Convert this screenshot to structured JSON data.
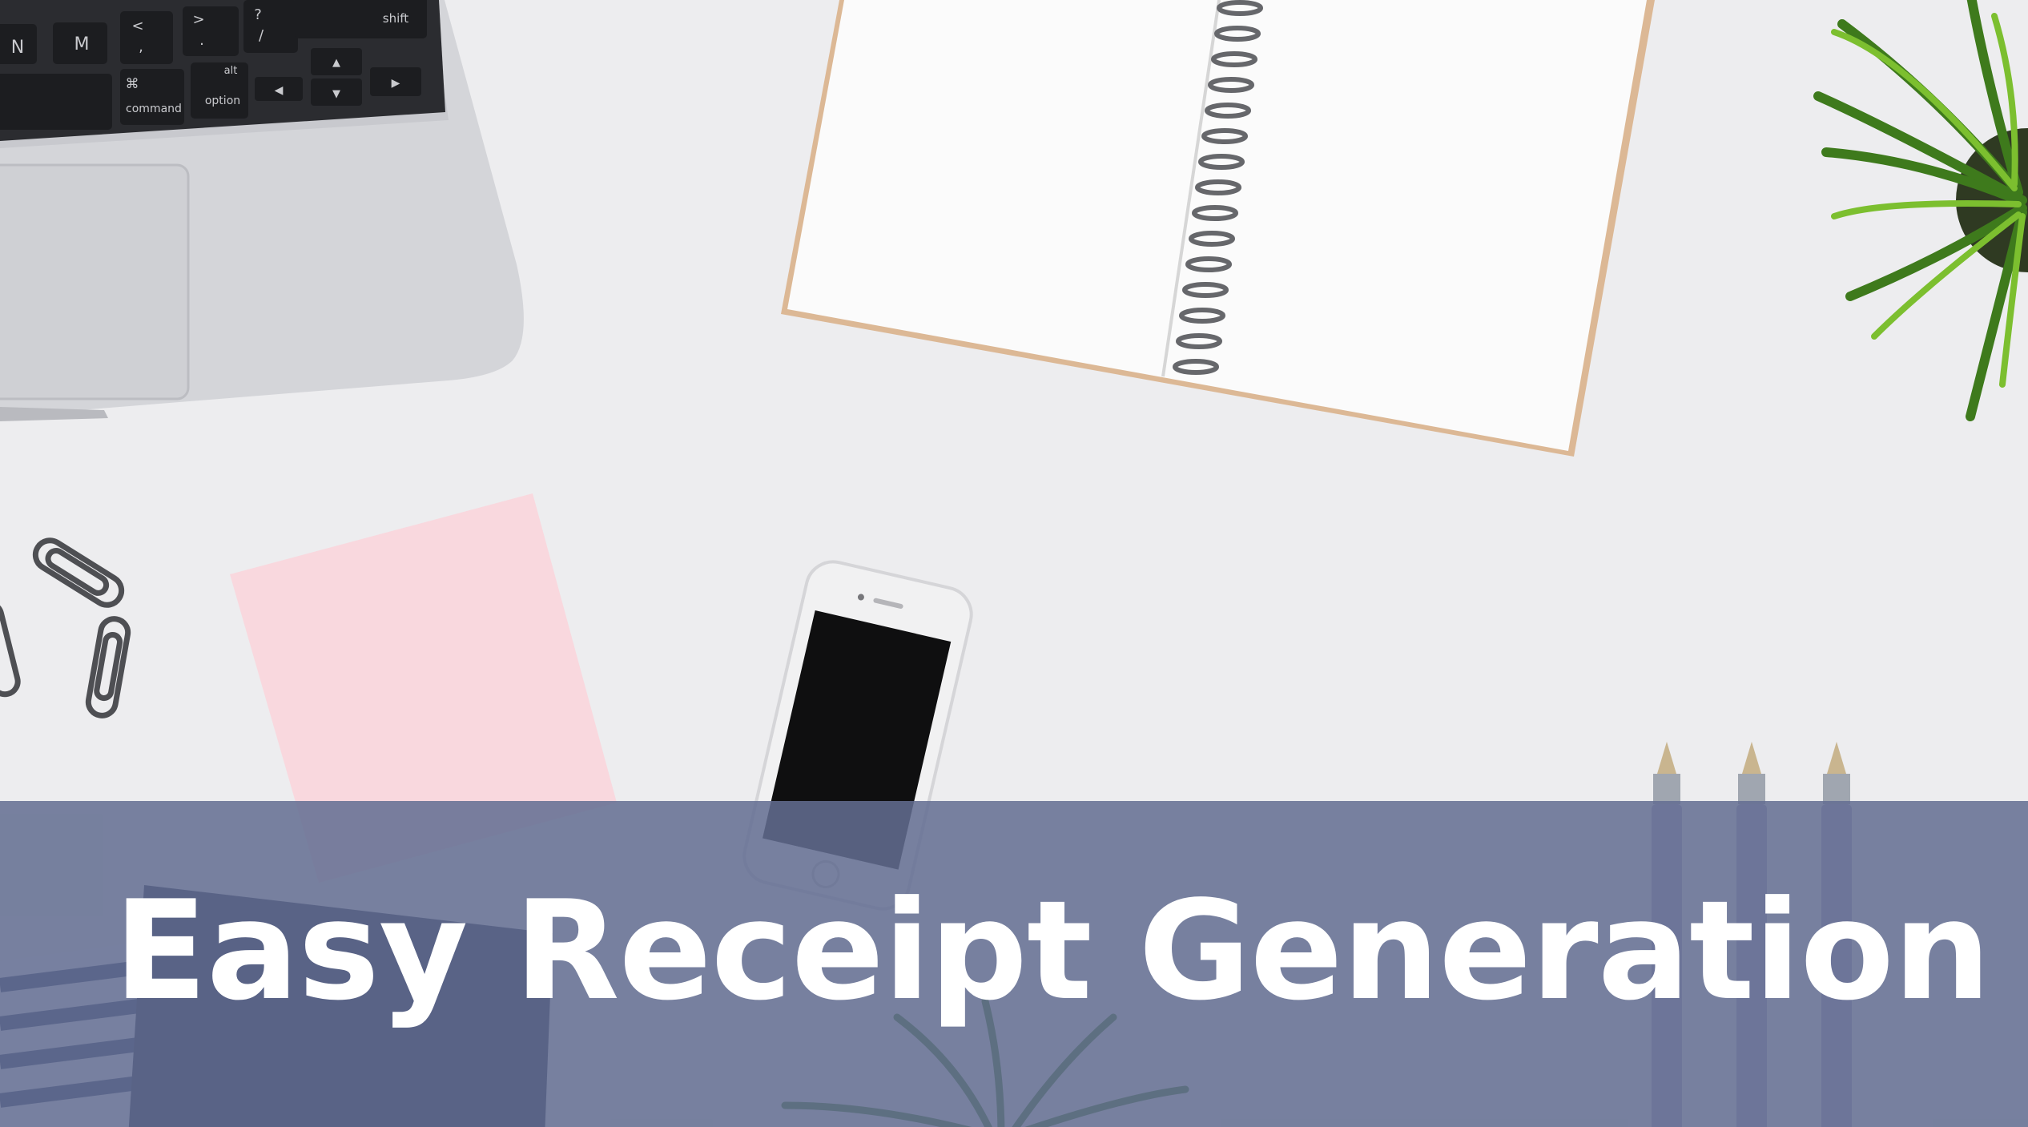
{
  "headline": "Easy Receipt Generation",
  "keyboard": {
    "keys": [
      "N",
      "M",
      "<",
      ">",
      "?",
      "shift",
      "command",
      "option"
    ],
    "secondary": [
      ",",
      ".",
      "/",
      "⌘",
      "alt"
    ]
  },
  "colors": {
    "background": "#ededef",
    "banner": "#636e91",
    "headline": "#ffffff",
    "sticky_note": "#f9d8de",
    "notebook": "#fbfbfb",
    "laptop": "#d3d4d8",
    "plant": "#3f7a1f",
    "pens": "#a59bbd",
    "navy_folder": "#1f2744"
  }
}
